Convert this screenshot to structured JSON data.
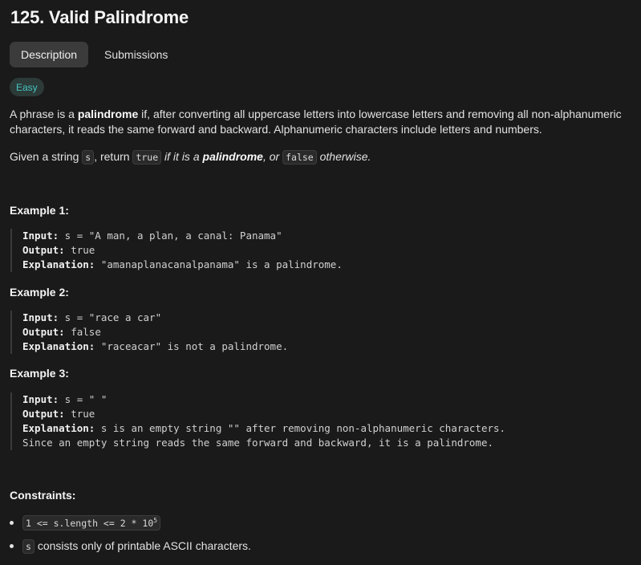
{
  "problem": {
    "title": "125. Valid Palindrome",
    "difficulty": "Easy"
  },
  "tabs": [
    {
      "label": "Description",
      "active": true
    },
    {
      "label": "Submissions",
      "active": false
    }
  ],
  "description": {
    "p1_a": "A phrase is a ",
    "p1_bold": "palindrome",
    "p1_b": " if, after converting all uppercase letters into lowercase letters and removing all non-alphanumeric characters, it reads the same forward and backward. Alphanumeric characters include letters and numbers.",
    "p2_a": "Given a string ",
    "p2_code_s": "s",
    "p2_b": ", return ",
    "p2_code_true": "true",
    "p2_c": " if it is a ",
    "p2_bold": "palindrome",
    "p2_d": ", or ",
    "p2_code_false": "false",
    "p2_e": " otherwise."
  },
  "examples": [
    {
      "title": "Example 1:",
      "input_label": "Input:",
      "input": " s = \"A man, a plan, a canal: Panama\"",
      "output_label": "Output:",
      "output": " true",
      "explanation_label": "Explanation:",
      "explanation": " \"amanaplanacanalpanama\" is a palindrome."
    },
    {
      "title": "Example 2:",
      "input_label": "Input:",
      "input": " s = \"race a car\"",
      "output_label": "Output:",
      "output": " false",
      "explanation_label": "Explanation:",
      "explanation": " \"raceacar\" is not a palindrome."
    },
    {
      "title": "Example 3:",
      "input_label": "Input:",
      "input": " s = \" \"",
      "output_label": "Output:",
      "output": " true",
      "explanation_label": "Explanation:",
      "explanation": " s is an empty string \"\" after removing non-alphanumeric characters.",
      "explanation_2": "Since an empty string reads the same forward and backward, it is a palindrome."
    }
  ],
  "constraints": {
    "title": "Constraints:",
    "c1_code": "1 <= s.length <= 2 * 10",
    "c1_sup": "5",
    "c2_code": "s",
    "c2_text": " consists only of printable ASCII characters."
  }
}
